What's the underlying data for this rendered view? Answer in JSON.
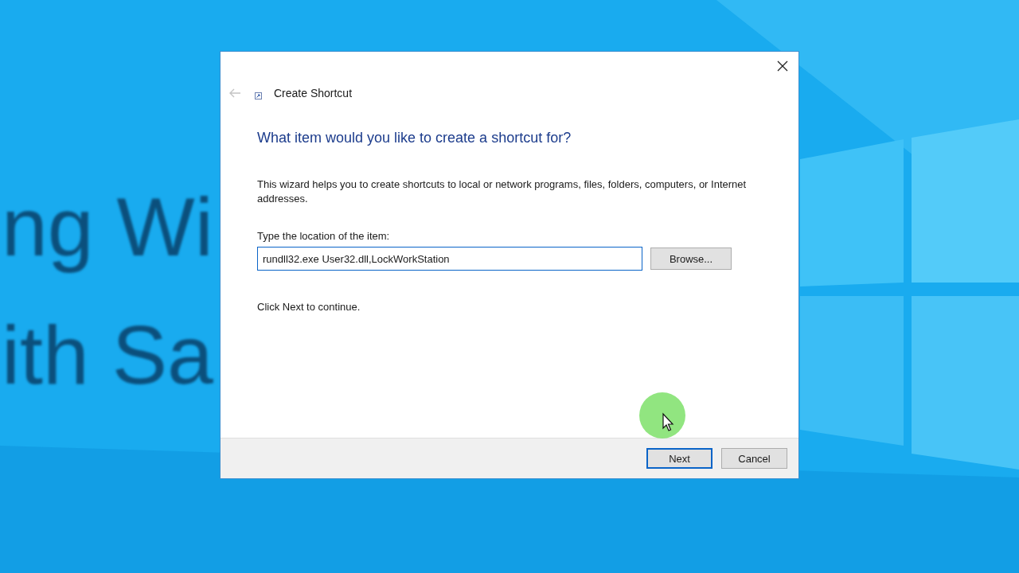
{
  "background_text": [
    "ng Wi",
    "ith Sa"
  ],
  "dialog": {
    "back": {
      "disabled": true
    },
    "title": "Create Shortcut",
    "heading": "What item would you like to create a shortcut for?",
    "description": "This wizard helps you to create shortcuts to local or network programs, files, folders, computers, or Internet addresses.",
    "field_label": "Type the location of the item:",
    "location": {
      "value": "rundll32.exe User32.dll,LockWorkStation",
      "focused": true
    },
    "browse_button": "Browse...",
    "hint": "Click Next to continue.",
    "buttons": [
      {
        "label": "Next",
        "default": true
      },
      {
        "label": "Cancel",
        "default": false
      }
    ]
  }
}
